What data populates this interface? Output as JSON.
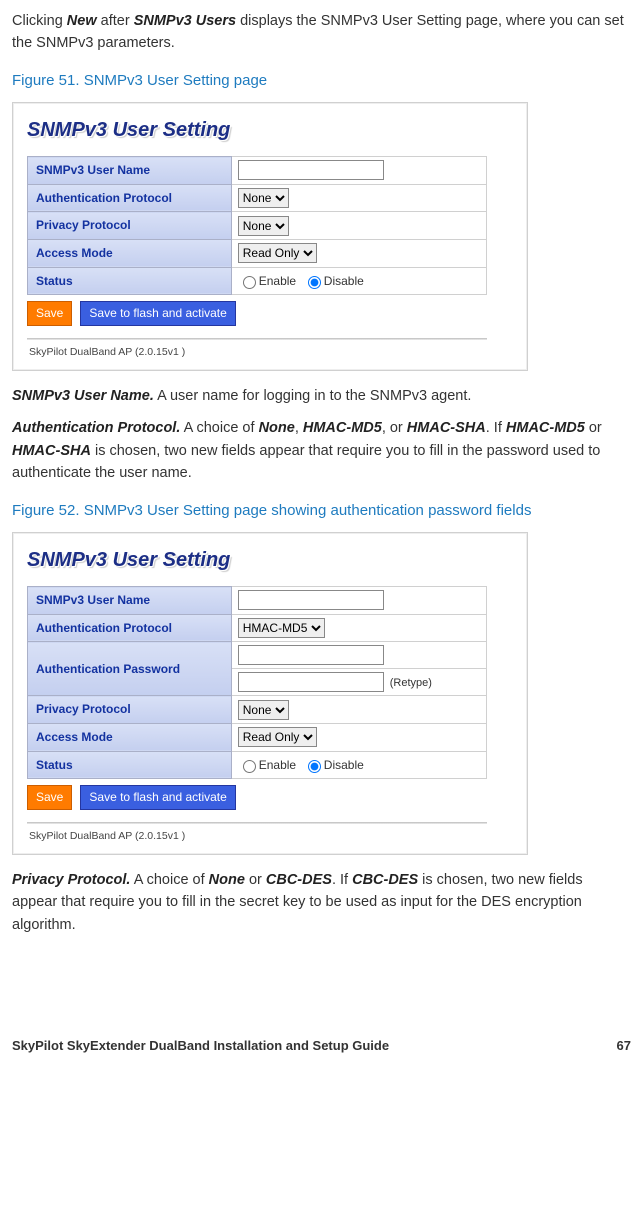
{
  "intro": {
    "p1_pre": "Clicking ",
    "new": "New",
    "p1_mid": " after ",
    "snmpv3_users": "SNMPv3 Users",
    "p1_post": " displays the SNMPv3 User Setting page, where you can set the SNMPv3 parameters."
  },
  "fig51_cap": "Figure 51. SNMPv3 User Setting page",
  "panel_title": "SNMPv3 User Setting",
  "labels": {
    "username": "SNMPv3 User Name",
    "authproto": "Authentication Protocol",
    "authpass": "Authentication Password",
    "privproto": "Privacy Protocol",
    "accessmode": "Access Mode",
    "status": "Status"
  },
  "selects": {
    "none": "None",
    "hmacmd5": "HMAC-MD5",
    "readonly": "Read Only"
  },
  "radio": {
    "enable": "Enable",
    "disable": "Disable"
  },
  "retype": "(Retype)",
  "buttons": {
    "save": "Save",
    "saveflash": "Save to flash and activate"
  },
  "version": "SkyPilot DualBand AP (2.0.15v1 )",
  "desc": {
    "username_term": "SNMPv3 User Name.",
    "username_body": " A user name for logging in to the SNMPv3 agent.",
    "auth_term": "Authentication Protocol.",
    "auth_b1": " A choice of ",
    "none": "None",
    "sep1": ", ",
    "hmacmd5": "HMAC-MD5",
    "sep2": ", or ",
    "hmacsha": "HMAC-SHA",
    "period": ". ",
    "if": "If ",
    "hmacmd5_2": "HMAC-MD5",
    "or": " or ",
    "hmacsha_2": "HMAC-SHA",
    "auth_tail": " is chosen, two new fields appear that require you to fill in the password used to authenticate the user name.",
    "priv_term": "Privacy Protocol.",
    "priv_b1": " A choice of ",
    "none2": "None",
    "or2": " or ",
    "cbcdes": "CBC-DES",
    "period2": ". ",
    "if2": "If ",
    "cbcdes2": "CBC-DES",
    "priv_tail": " is chosen, two new fields appear that require you to fill in the secret key to be used as input for the DES encryption algorithm."
  },
  "fig52_cap": "Figure 52. SNMPv3 User Setting page showing authentication password fields",
  "footer": {
    "title": "SkyPilot SkyExtender DualBand Installation and Setup Guide",
    "page": "67"
  }
}
